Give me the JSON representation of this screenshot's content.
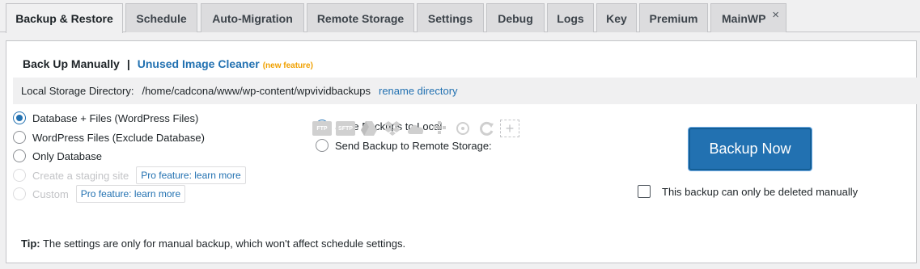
{
  "tabs": [
    {
      "label": "Backup & Restore",
      "active": true
    },
    {
      "label": "Schedule"
    },
    {
      "label": "Auto-Migration"
    },
    {
      "label": "Remote Storage"
    },
    {
      "label": "Settings"
    },
    {
      "label": "Debug"
    },
    {
      "label": "Logs"
    },
    {
      "label": "Key"
    },
    {
      "label": "Premium"
    },
    {
      "label": "MainWP",
      "close": "×"
    }
  ],
  "heading": {
    "title": "Back Up Manually",
    "separator": "|",
    "link": "Unused Image Cleaner",
    "badge": "(new feature)"
  },
  "directory": {
    "label": "Local Storage Directory:",
    "path": "/home/cadcona/www/wp-content/wpvividbackups",
    "rename": "rename directory"
  },
  "backup_content": [
    {
      "label": "Database + Files (WordPress Files)",
      "selected": true
    },
    {
      "label": "WordPress Files (Exclude Database)",
      "selected": false
    },
    {
      "label": "Only Database",
      "selected": false
    },
    {
      "label": "Create a staging site",
      "disabled": true,
      "pro": "Pro feature: learn more"
    },
    {
      "label": "Custom",
      "disabled": true,
      "pro": "Pro feature: learn more"
    }
  ],
  "destination": [
    {
      "label": "Save Backups to Local",
      "selected": true
    },
    {
      "label": "Send Backup to Remote Storage:",
      "selected": false
    }
  ],
  "storage_icons": [
    {
      "name": "ftp-icon",
      "text": "FTP"
    },
    {
      "name": "sftp-icon",
      "text": "SFTP"
    },
    {
      "name": "google-drive-icon"
    },
    {
      "name": "dropbox-icon"
    },
    {
      "name": "onedrive-icon"
    },
    {
      "name": "amazon-s3-icon"
    },
    {
      "name": "wasabi-icon"
    },
    {
      "name": "backblaze-icon"
    },
    {
      "name": "add-storage-icon",
      "text": "+"
    }
  ],
  "backup_button": "Backup Now",
  "manual_delete_label": "This backup can only be deleted manually",
  "tip": {
    "label": "Tip:",
    "text": " The settings are only for manual backup, which won't affect schedule settings."
  },
  "colors": {
    "accent": "#2271b1",
    "badge": "#f0a000"
  }
}
